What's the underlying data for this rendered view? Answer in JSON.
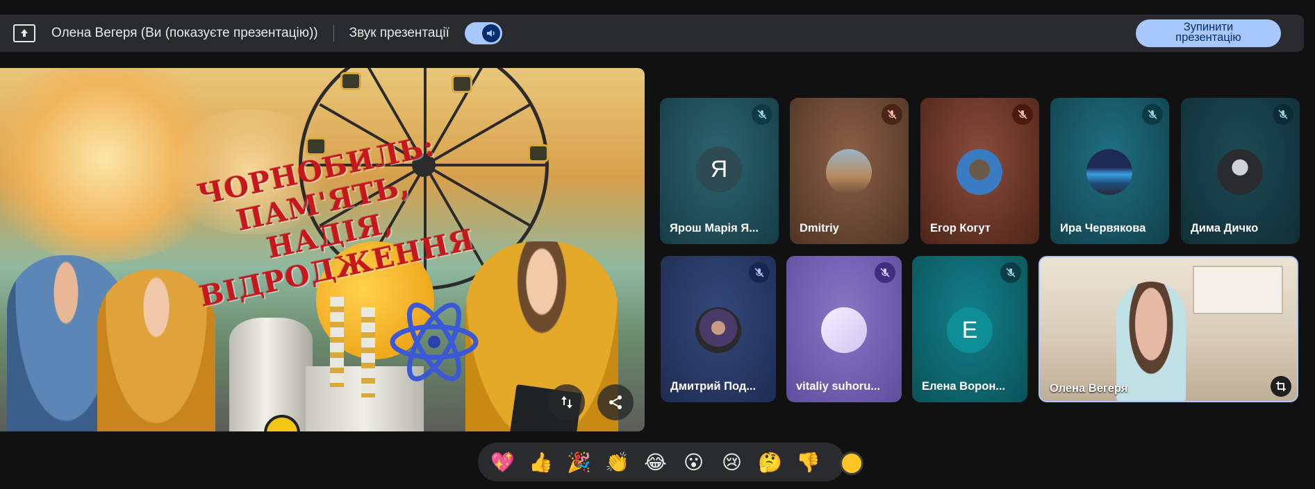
{
  "topbar": {
    "presenter": "Олена Вегеря (Ви (показуєте презентацію))",
    "audio_label": "Звук презентації",
    "audio_on": true,
    "stop_line1": "Зупинити",
    "stop_line2": "презентацію"
  },
  "slide": {
    "title_line1": "ЧОРНОБИЛЬ: ПАМ'ЯТЬ,",
    "title_line2": "НАДІЯ,",
    "title_line3": "ВІДРОДЖЕННЯ"
  },
  "participants": [
    {
      "name": "Ярош Марія Я...",
      "avatar": "Я",
      "muted": true,
      "bg": "#1f4e5a"
    },
    {
      "name": "Dmitriy",
      "muted": true,
      "bg": "#6b4a36"
    },
    {
      "name": "Егор Когут",
      "muted": true,
      "bg": "#6a3a2e"
    },
    {
      "name": "Ира Червякова",
      "muted": true,
      "bg": "#1b5a66"
    },
    {
      "name": "Дима Дичко",
      "muted": true,
      "bg": "#17414c"
    },
    {
      "name": "Дмитрий Под...",
      "muted": true,
      "bg": "#283c66"
    },
    {
      "name": "vitaliy suhoru...",
      "muted": true,
      "bg": "#6a5aa8"
    },
    {
      "name": "Елена Ворон...",
      "avatar": "E",
      "muted": true,
      "bg": "#0e6a73"
    },
    {
      "name": "Олена Вегеря",
      "muted": false,
      "bg": "#d9cdbc"
    }
  ],
  "reactions": [
    "💖",
    "👍",
    "🎉",
    "👏",
    "😂",
    "😮",
    "😢",
    "🤔",
    "👎"
  ],
  "colors": {
    "accent": "#a8c7fa",
    "accent_dark": "#062e6f",
    "bar_bg": "#2a2b2e"
  }
}
